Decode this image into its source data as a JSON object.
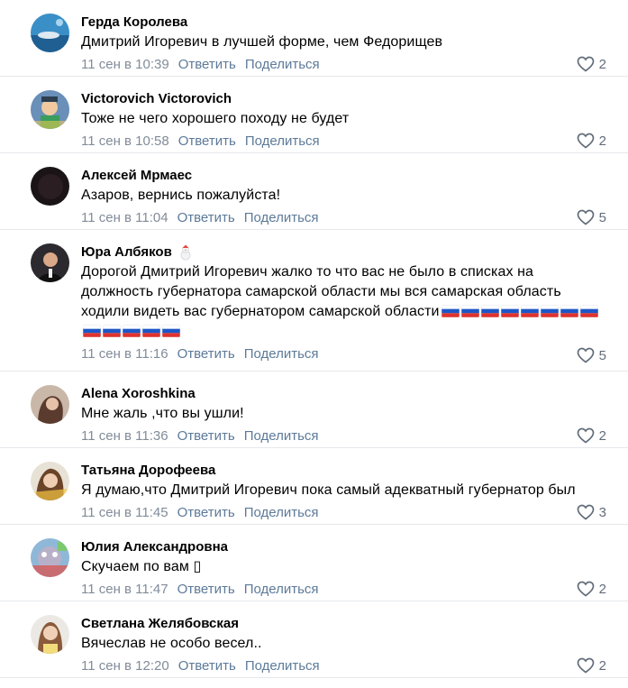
{
  "comments": [
    {
      "author": "Герда Королева",
      "text": "Дмитрий Игоревич в лучшей форме, чем Федорищев",
      "date": "11 сен в 10:39",
      "reply": "Ответить",
      "share": "Поделиться",
      "likes": "2"
    },
    {
      "author": "Victorovich Victorovich",
      "text": "Тоже не чего хорошего походу не будет",
      "date": "11 сен в 10:58",
      "reply": "Ответить",
      "share": "Поделиться",
      "likes": "2"
    },
    {
      "author": "Алексей Мрмаес",
      "text": "Азаров, вернись пожалуйста!",
      "date": "11 сен в 11:04",
      "reply": "Ответить",
      "share": "Поделиться",
      "likes": "5"
    },
    {
      "author": "Юра Албяков",
      "text": "Дорогой Дмитрий Игоревич жалко то что вас не было в списках на должность губернатора самарской области мы вся самарская область ходили видеть вас губернатором самарской области",
      "date": "11 сен в 11:16",
      "reply": "Ответить",
      "share": "Поделиться",
      "likes": "5",
      "flag_count": 13
    },
    {
      "author": "Alena Xoroshkina",
      "text": "Мне жаль ,что вы ушли!",
      "date": "11 сен в 11:36",
      "reply": "Ответить",
      "share": "Поделиться",
      "likes": "2"
    },
    {
      "author": "Татьяна Дорофеева",
      "text": "Я думаю,что Дмитрий Игоревич пока самый адекватный губернатор был",
      "date": "11 сен в 11:45",
      "reply": "Ответить",
      "share": "Поделиться",
      "likes": "3"
    },
    {
      "author": "Юлия Александровна",
      "text": "Скучаем по вам ▯",
      "date": "11 сен в 11:47",
      "reply": "Ответить",
      "share": "Поделиться",
      "likes": "2"
    },
    {
      "author": "Светлана Желябовская",
      "text": "Вячеслав не особо весел..",
      "date": "11 сен в 12:20",
      "reply": "Ответить",
      "share": "Поделиться",
      "likes": "2"
    }
  ],
  "icons": {
    "like": "heart-outline-icon",
    "flag": "russian-flag-emoji",
    "sticker": "snowman-emoji"
  },
  "colors": {
    "link": "#5d7a99",
    "meta": "#818c99",
    "divider": "#e7e8ec"
  }
}
